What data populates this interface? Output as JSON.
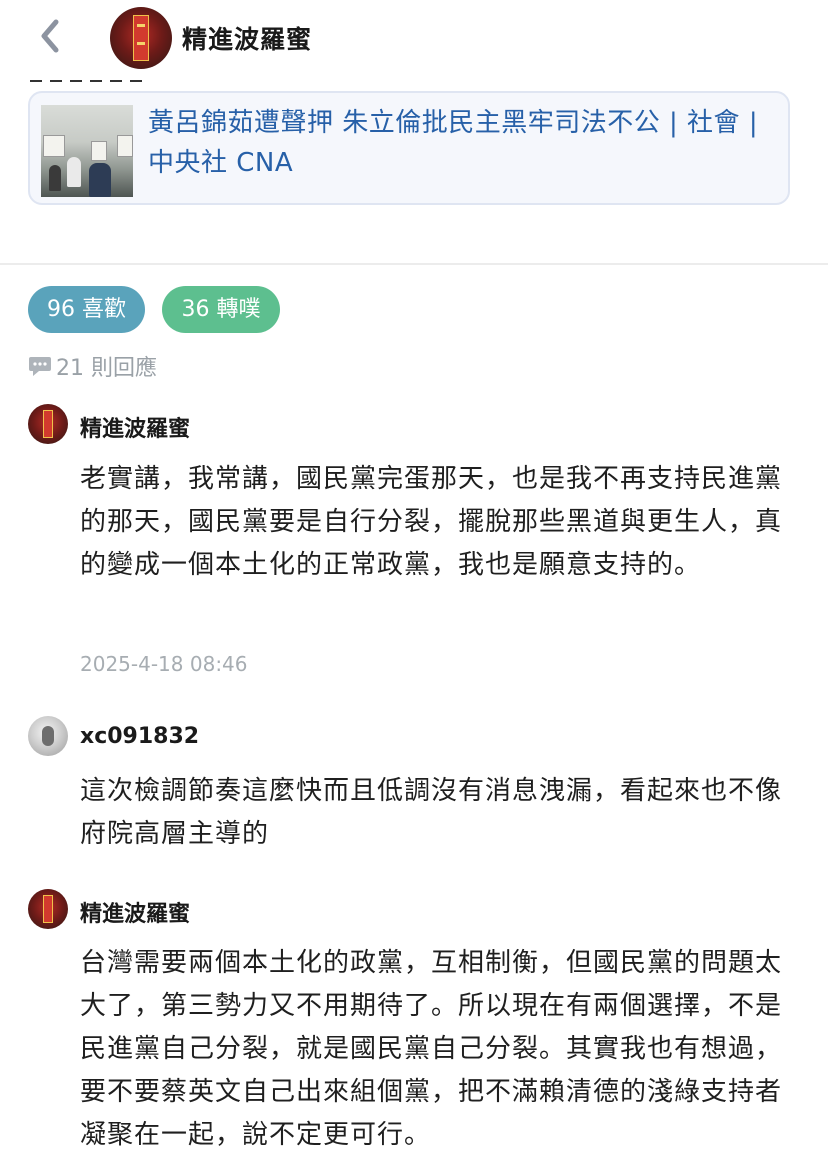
{
  "header": {
    "title": "精進波羅蜜",
    "back_icon": "chevron-left-icon"
  },
  "link_card": {
    "title": "黃呂錦茹遭聲押 朱立倫批民主黑牢司法不公 | 社會 | 中央社 CNA"
  },
  "stats": {
    "likes": "96 喜歡",
    "replurks": "36 轉噗",
    "responses": "21 則回應"
  },
  "comments": [
    {
      "user": "精進波羅蜜",
      "text": "老實講，我常講，國民黨完蛋那天，也是我不再支持民進黨的那天，國民黨要是自行分裂，擺脫那些黑道與更生人，真的變成一個本土化的正常政黨，我也是願意支持的。",
      "time": "2025-4-18 08:46"
    },
    {
      "user": "xc091832",
      "text": "這次檢調節奏這麼快而且低調沒有消息洩漏，看起來也不像府院高層主導的"
    },
    {
      "user": "精進波羅蜜",
      "text": "台灣需要兩個本土化的政黨，互相制衡，但國民黨的問題太大了，第三勢力又不用期待了。所以現在有兩個選擇，不是民進黨自己分裂，就是國民黨自己分裂。其實我也有想過，要不要蔡英文自己出來組個黨，把不滿賴清德的淺綠支持者凝聚在一起，說不定更可行。"
    }
  ],
  "colors": {
    "link": "#2760a8",
    "like_pill": "#5aa3bb",
    "replurk_pill": "#5dbf8f",
    "muted": "#9aa1a7"
  }
}
